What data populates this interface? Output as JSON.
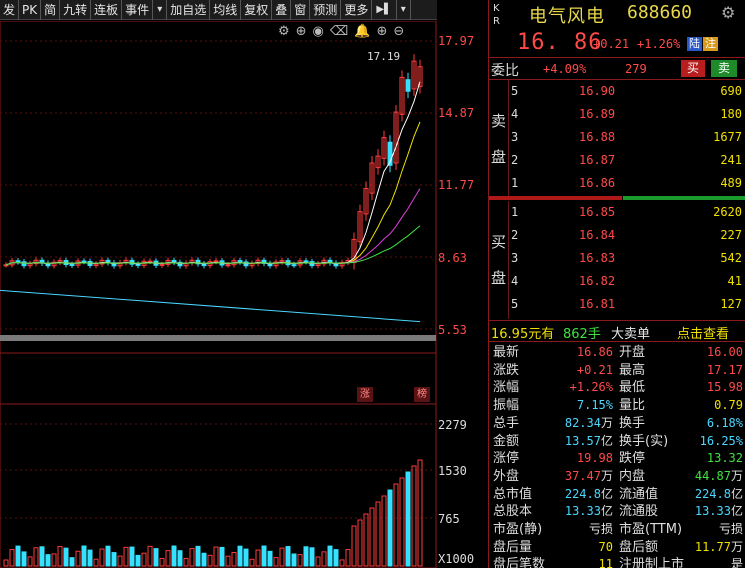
{
  "toolbar": {
    "items": [
      "发",
      "PK",
      "简",
      "九转",
      "连板",
      "事件",
      "▾",
      "加自选",
      "均线",
      "复权",
      "叠",
      "窗",
      "预测",
      "更多",
      "▶▌",
      "▾"
    ]
  },
  "chart": {
    "price_axis": [
      "17.97",
      "14.87",
      "11.77",
      "8.63",
      "5.53"
    ],
    "high_label": "17.19",
    "volume_axis": [
      "2279",
      "1530",
      "765",
      "X1000"
    ],
    "tags": [
      "涨",
      "榜"
    ],
    "icons": [
      "gear-icon",
      "zoom-in-icon",
      "eye-icon",
      "delete-icon",
      "bell-icon",
      "plus-circle-icon",
      "minus-circle-icon"
    ]
  },
  "chart_data": {
    "type": "candlestick",
    "price_ylim": [
      5.53,
      17.97
    ],
    "current_high": 17.19
  },
  "header": {
    "kr": "K R",
    "name": "电气风电",
    "code": "688660",
    "price": "16. 86",
    "change": "+0.21",
    "change_pct": "+1.26%",
    "badge_lu": "陆",
    "badge_zhu": "注"
  },
  "weibi": {
    "label": "委比",
    "ratio": "+4.09%",
    "diff": "279",
    "buy": "买",
    "sell": "卖"
  },
  "sell_side": "卖 盘",
  "buy_side": "买 盘",
  "asks": [
    {
      "n": "5",
      "p": "16.90",
      "v": "690"
    },
    {
      "n": "4",
      "p": "16.89",
      "v": "180"
    },
    {
      "n": "3",
      "p": "16.88",
      "v": "1677"
    },
    {
      "n": "2",
      "p": "16.87",
      "v": "241"
    },
    {
      "n": "1",
      "p": "16.86",
      "v": "489"
    }
  ],
  "bids": [
    {
      "n": "1",
      "p": "16.85",
      "v": "2620"
    },
    {
      "n": "2",
      "p": "16.84",
      "v": "227"
    },
    {
      "n": "3",
      "p": "16.83",
      "v": "542"
    },
    {
      "n": "4",
      "p": "16.82",
      "v": "41"
    },
    {
      "n": "5",
      "p": "16.81",
      "v": "127"
    }
  ],
  "trade": {
    "price": "16.95元有",
    "qty": "862手",
    "type": "大卖单",
    "link": "点击查看"
  },
  "stats_left": [
    {
      "k": "最新",
      "v": "16.86",
      "c": "red"
    },
    {
      "k": "涨跌",
      "v": "+0.21",
      "c": "red"
    },
    {
      "k": "涨幅",
      "v": "+1.26%",
      "c": "red"
    },
    {
      "k": "振幅",
      "v": "7.15%",
      "c": "cyan"
    },
    {
      "k": "总手",
      "v": "82.34",
      "u": "万",
      "c": "cyan"
    },
    {
      "k": "金额",
      "v": "13.57",
      "u": "亿",
      "c": "cyan"
    },
    {
      "k": "涨停",
      "v": "19.98",
      "c": "red"
    },
    {
      "k": "外盘",
      "v": "37.47",
      "u": "万",
      "c": "red"
    },
    {
      "k": "总市值",
      "v": "224.8",
      "u": "亿",
      "c": "cyan"
    },
    {
      "k": "总股本",
      "v": "13.33",
      "u": "亿",
      "c": "cyan"
    },
    {
      "k": "市盈(静)",
      "v": "亏损",
      "c": "white"
    },
    {
      "k": "盘后量",
      "v": "70",
      "c": "yellow"
    },
    {
      "k": "盘后笔数",
      "v": "11",
      "c": "yellow"
    }
  ],
  "stats_right": [
    {
      "k": "开盘",
      "v": "16.00",
      "c": "red"
    },
    {
      "k": "最高",
      "v": "17.17",
      "c": "red"
    },
    {
      "k": "最低",
      "v": "15.98",
      "c": "red"
    },
    {
      "k": "量比",
      "v": "0.79",
      "c": "yellow"
    },
    {
      "k": "换手",
      "v": "6.18%",
      "c": "cyan"
    },
    {
      "k": "换手(实)",
      "v": "16.25%",
      "c": "cyan"
    },
    {
      "k": "跌停",
      "v": "13.32",
      "c": "green"
    },
    {
      "k": "内盘",
      "v": "44.87",
      "u": "万",
      "c": "green"
    },
    {
      "k": "流通值",
      "v": "224.8",
      "u": "亿",
      "c": "cyan"
    },
    {
      "k": "流通股",
      "v": "13.33",
      "u": "亿",
      "c": "cyan"
    },
    {
      "k": "市盈(TTM)",
      "v": "亏损",
      "c": "white"
    },
    {
      "k": "盘后额",
      "v": "11.77",
      "u": "万",
      "c": "yellow"
    },
    {
      "k": "注册制上市",
      "v": "是",
      "c": "white"
    }
  ]
}
